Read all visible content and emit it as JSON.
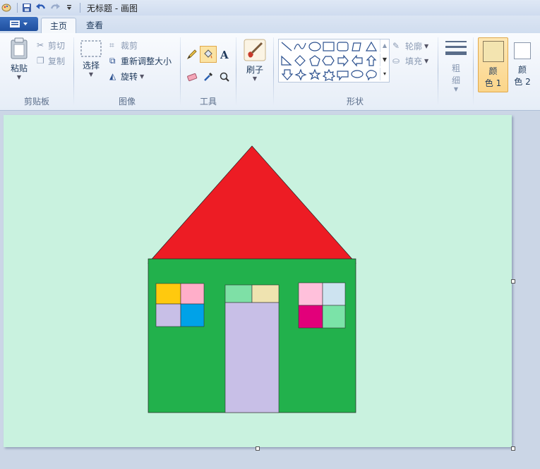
{
  "window": {
    "title": "无标题 - 画图"
  },
  "icons": {
    "app": "paint-palette-icon",
    "save": "save-icon",
    "undo": "undo-icon",
    "redo": "redo-icon",
    "customize": "dropdown-arrow-icon"
  },
  "tabs": [
    {
      "label": "主页",
      "active": true
    },
    {
      "label": "查看",
      "active": false
    }
  ],
  "ribbon": {
    "clipboard": {
      "group_label": "剪贴板",
      "paste": "粘贴",
      "cut": "剪切",
      "copy": "复制"
    },
    "image": {
      "group_label": "图像",
      "select": "选择",
      "crop": "裁剪",
      "resize": "重新调整大小",
      "rotate": "旋转"
    },
    "tools": {
      "group_label": "工具"
    },
    "brushes": {
      "label": "刷子"
    },
    "shapes": {
      "group_label": "形状",
      "outline": "轮廓",
      "fill": "填充"
    },
    "size": {
      "label_line1": "粗",
      "label_line2": "细"
    },
    "color1": {
      "label_line1": "颜",
      "label_line2": "色 1",
      "value": "#f3e4b0"
    },
    "color2": {
      "label_line1": "颜",
      "label_line2": "色 2",
      "value": "#ffffff"
    }
  },
  "drawing": {
    "background": "#c9f2df",
    "roof_color": "#ed1c24",
    "wall_color": "#22b14c",
    "door_color": "#c8bfe7",
    "left_window": [
      "#ffc90e",
      "#ffaec9",
      "#c8bfe7",
      "#00a2e8"
    ],
    "right_window": [
      "#ffc0db",
      "#cde3f0",
      "#e2007a",
      "#7be3a8"
    ],
    "transom": [
      "#7ee0a6",
      "#efe3b0"
    ]
  }
}
